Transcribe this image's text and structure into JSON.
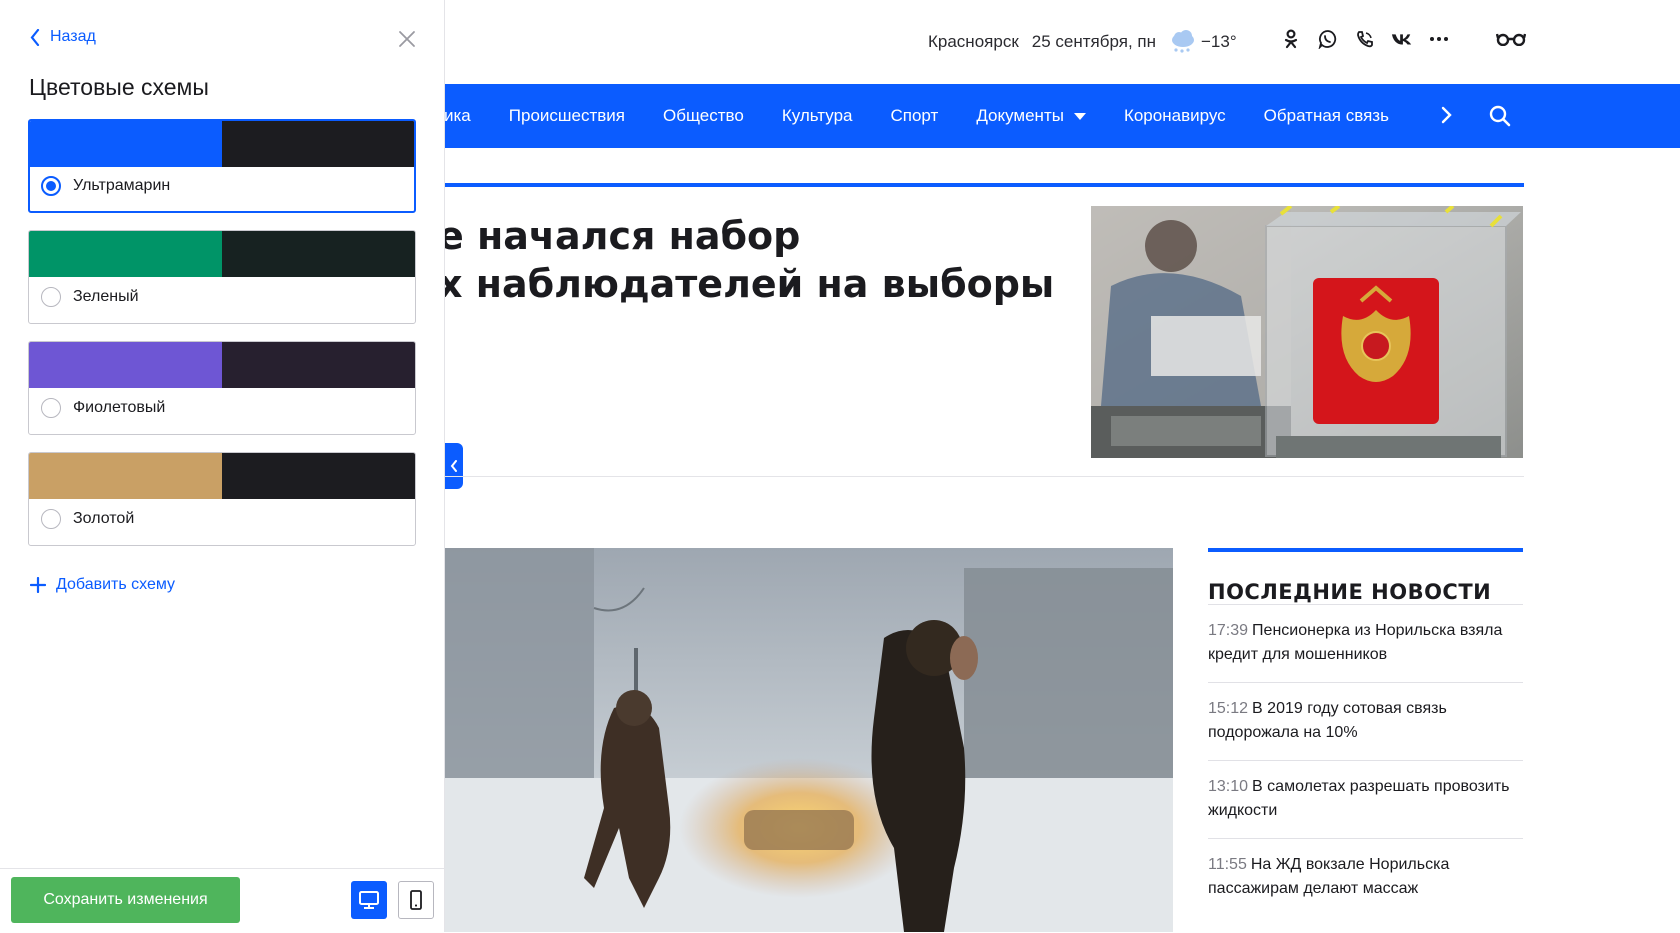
{
  "header": {
    "city": "Красноярск",
    "date": "25 сентября, пн",
    "temperature": "−13°",
    "icons": [
      "odnoklassniki-icon",
      "whatsapp-icon",
      "viber-icon",
      "vk-icon",
      "more-icon",
      "glasses-icon"
    ]
  },
  "nav": {
    "items": [
      "ика",
      "Происшествия",
      "Общество",
      "Культура",
      "Спорт",
      "Документы",
      "Коронавирус",
      "Обратная связь"
    ],
    "accent": "#0b5cff"
  },
  "featured": {
    "headline_line1": "е начался набор",
    "headline_line2": "х наблюдателей на выборы в"
  },
  "latest": {
    "title": "ПОСЛЕДНИЕ НОВОСТИ",
    "items": [
      {
        "time": "17:39",
        "text": "Пенсионерка из Норильска взяла кредит для мошенников"
      },
      {
        "time": "15:12",
        "text": "В 2019 году сотовая связь подорожала на 10%"
      },
      {
        "time": "13:10",
        "text": "В самолетах разрешать провозить жидкости"
      },
      {
        "time": "11:55",
        "text": "На ЖД вокзале Норильска пассажирам делают массаж"
      }
    ]
  },
  "panel": {
    "back_label": "Назад",
    "title": "Цветовые схемы",
    "schemes": [
      {
        "label": "Ультрамарин",
        "primary": "#0b5cff",
        "dark": "#1c1c20",
        "selected": true
      },
      {
        "label": "Зеленый",
        "primary": "#009467",
        "dark": "#172221",
        "selected": false
      },
      {
        "label": "Фиолетовый",
        "primary": "#6e56d4",
        "dark": "#27202f",
        "selected": false
      },
      {
        "label": "Золотой",
        "primary": "#c9a065",
        "dark": "#1c1c20",
        "selected": false
      }
    ],
    "add_label": "Добавить схему",
    "save_label": "Сохранить изменения",
    "save_color": "#4fb55c"
  }
}
